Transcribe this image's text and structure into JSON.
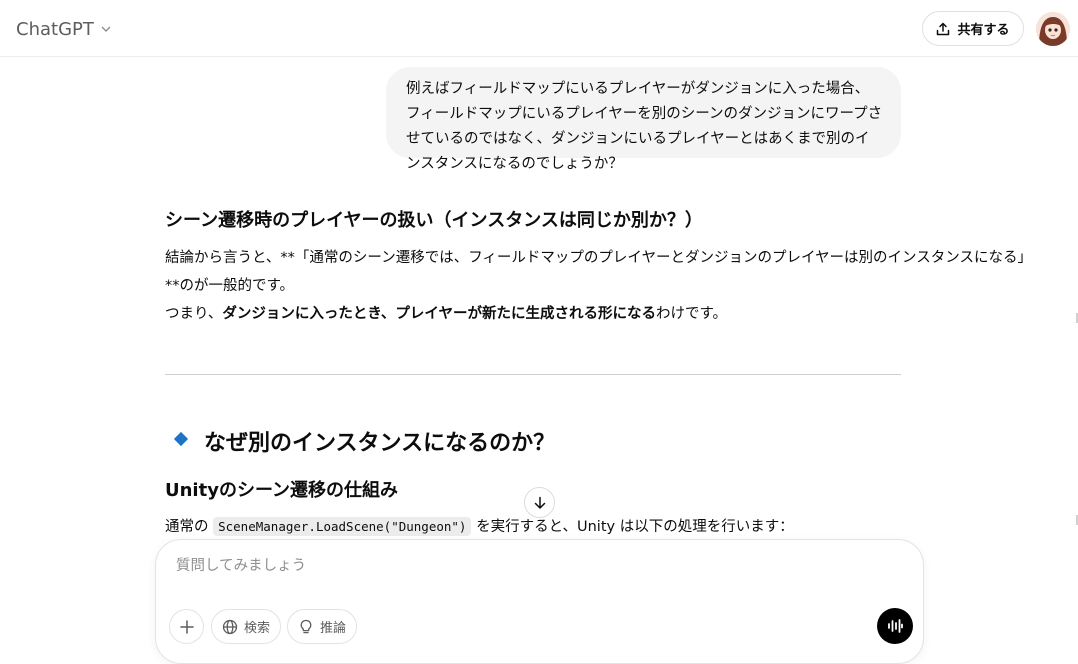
{
  "header": {
    "model_name": "ChatGPT",
    "share_label": "共有する"
  },
  "user_message": {
    "text": "例えばフィールドマップにいるプレイヤーがダンジョンに入った場合、フィールドマップにいるプレイヤーを別のシーンのダンジョンにワープさせているのではなく、ダンジョンにいるプレイヤーとはあくまで別のインスタンスになるのでしょうか？"
  },
  "assistant": {
    "heading": "シーン遷移時のプレイヤーの扱い（インスタンスは同じか別か？）",
    "conclusion_line1": "結論から言うと、**「通常のシーン遷移では、フィールドマップのプレイヤーとダンジョンのプレイヤーは別のインスタンスになる」",
    "conclusion_line2": "**のが一般的です。",
    "line3_a": "つまり、",
    "line3_b": "ダンジョンに入ったとき、プレイヤーが新たに生成される形になる",
    "line3_c": "わけです。",
    "section_heading": "なぜ別のインスタンスになるのか？",
    "sub_heading": "Unityのシーン遷移の仕組み",
    "body_prefix": "通常の",
    "body_code": "SceneManager.LoadScene(\"Dungeon\")",
    "body_suffix": "を実行すると、Unity は以下の処理を行います："
  },
  "composer": {
    "placeholder": "質問してみましょう",
    "search_label": "検索",
    "reason_label": "推論"
  },
  "icons": {
    "share": "upload-icon",
    "plus": "plus-icon",
    "search": "globe-icon",
    "reason": "lightbulb-icon",
    "voice": "voice-waveform-icon",
    "scroll": "arrow-down-icon",
    "model_dropdown": "chevron-down-icon"
  },
  "colors": {
    "diamond_bullet": "#1b74c5",
    "voice_button": "#000000",
    "user_bubble": "#f4f4f4"
  }
}
